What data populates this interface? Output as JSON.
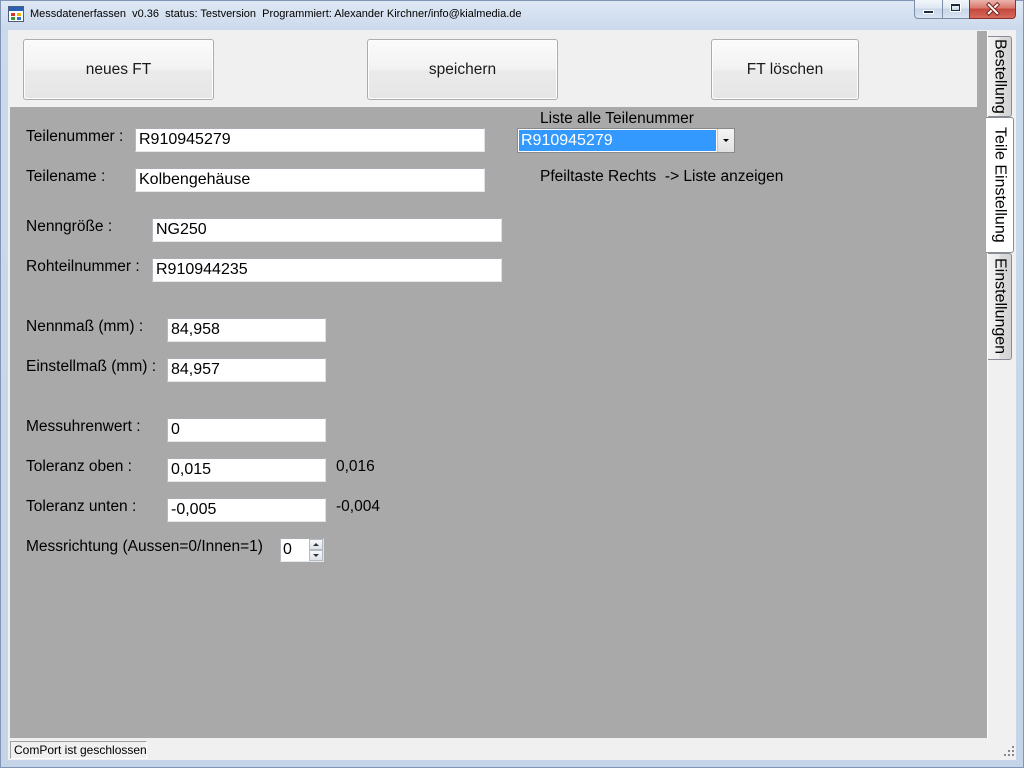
{
  "window": {
    "title": "Messdatenerfassen  v0.36  status: Testversion  Programmiert: Alexander Kirchner/info@kialmedia.de",
    "app_icon": "app-icon",
    "minimize_icon": "minimize-icon",
    "maximize_icon": "maximize-icon",
    "close_icon": "close-icon"
  },
  "toolbar": {
    "new_ft_label": "neues FT",
    "save_label": "speichern",
    "delete_ft_label": "FT löschen"
  },
  "tabs": [
    {
      "label": "Bestellung",
      "selected": false
    },
    {
      "label": "Teile Einstellung",
      "selected": true
    },
    {
      "label": "Einstellungen",
      "selected": false
    }
  ],
  "form": {
    "teilenummer": {
      "label": "Teilenummer :",
      "value": "R910945279"
    },
    "teilename": {
      "label": "Teilename :",
      "value": "Kolbengehäuse"
    },
    "nenngroesse": {
      "label": "Nenngröße :",
      "value": "NG250"
    },
    "rohteilnummer": {
      "label": "Rohteilnummer :",
      "value": "R910944235"
    },
    "nennmass": {
      "label": "Nennmaß (mm) :",
      "value": "84,958"
    },
    "einstellmass": {
      "label": "Einstellmaß (mm) :",
      "value": "84,957"
    },
    "messuhrenwert": {
      "label": "Messuhrenwert :",
      "value": "0"
    },
    "toleranz_oben": {
      "label": "Toleranz oben :",
      "value": "0,015",
      "side_value": "0,016"
    },
    "toleranz_unten": {
      "label": "Toleranz unten :",
      "value": "-0,005",
      "side_value": "-0,004"
    },
    "messrichtung": {
      "label": "Messrichtung (Aussen=0/Innen=1)",
      "value": "0",
      "up_icon": "spin-up-icon",
      "down_icon": "spin-down-icon"
    }
  },
  "parts_list": {
    "label": "Liste alle Teilenummer",
    "selected": "R910945279",
    "dropdown_icon": "chevron-down-icon",
    "hint": "Pfeiltaste Rechts  -> Liste anzeigen"
  },
  "status_bar": {
    "comport_status": "ComPort ist geschlossen",
    "grip_icon": "resize-grip-icon"
  },
  "colors": {
    "tab_page_background": "#a9a9a9",
    "window_background": "#f0f0f0",
    "selection_highlight": "#3399ff"
  }
}
